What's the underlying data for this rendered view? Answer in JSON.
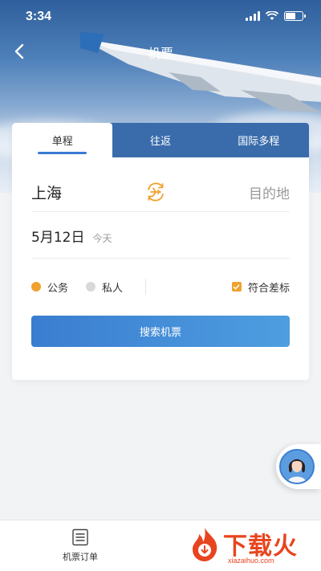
{
  "status_bar": {
    "time": "3:34"
  },
  "header": {
    "title": "机票"
  },
  "tabs": [
    {
      "label": "单程",
      "active": true
    },
    {
      "label": "往返",
      "active": false
    },
    {
      "label": "国际多程",
      "active": false
    }
  ],
  "route": {
    "from": "上海",
    "to": "目的地"
  },
  "date": {
    "value": "5月12日",
    "note": "今天"
  },
  "travel_type": {
    "options": [
      {
        "label": "公务",
        "selected": true,
        "color": "#f0a22e"
      },
      {
        "label": "私人",
        "selected": false,
        "color": "#d9d9d9"
      }
    ],
    "policy_label": "符合差标",
    "policy_checked": true
  },
  "search_button": {
    "label": "搜索机票"
  },
  "bottom_bar": {
    "orders_label": "机票订单"
  },
  "watermark": {
    "brand": "下载火",
    "url": "xiazaihuo.com"
  },
  "colors": {
    "accent": "#3a7dd0",
    "tab_bar": "#3a6cac",
    "orange": "#f0a22e",
    "watermark": "#e8441f"
  },
  "icons": {
    "back": "chevron-left-icon",
    "swap": "plane-swap-icon",
    "orders": "document-list-icon",
    "check": "checkbox-checked-icon"
  }
}
